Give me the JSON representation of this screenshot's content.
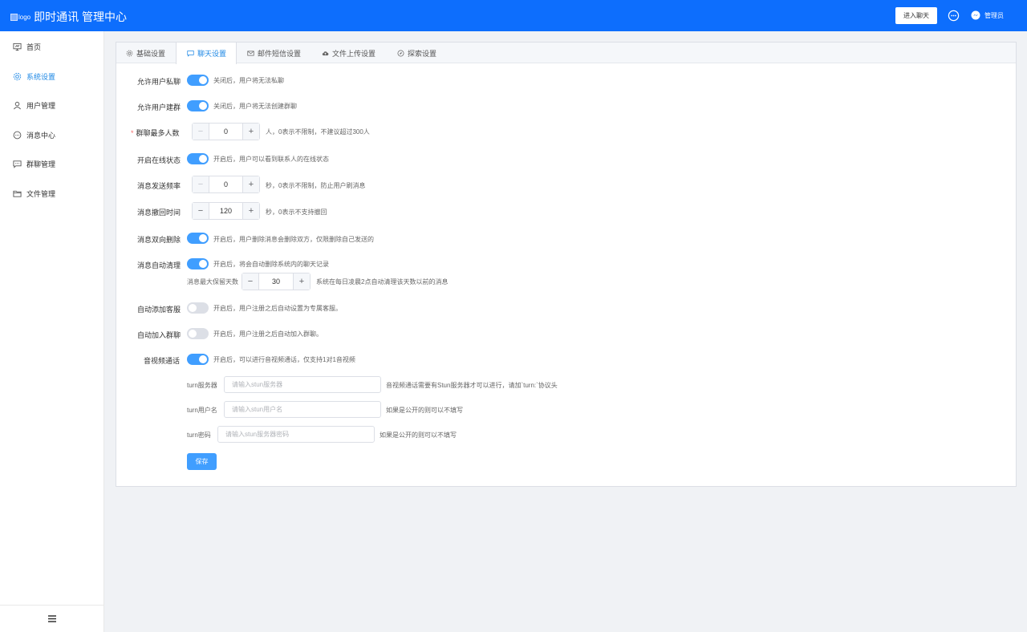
{
  "header": {
    "logo_alt": "logo",
    "title": "即时通讯 管理中心",
    "enter_chat": "进入聊天",
    "user": "管理员"
  },
  "sidebar": {
    "items": [
      {
        "label": "首页",
        "icon": "monitor-icon"
      },
      {
        "label": "系统设置",
        "icon": "gear-icon"
      },
      {
        "label": "用户管理",
        "icon": "user-icon"
      },
      {
        "label": "消息中心",
        "icon": "chat-bubble-icon"
      },
      {
        "label": "群聊管理",
        "icon": "group-chat-icon"
      },
      {
        "label": "文件管理",
        "icon": "folder-icon"
      }
    ],
    "active_index": 1
  },
  "tabs": [
    {
      "label": "基础设置",
      "icon": "gear-icon"
    },
    {
      "label": "聊天设置",
      "icon": "chat-icon"
    },
    {
      "label": "邮件短信设置",
      "icon": "mail-icon"
    },
    {
      "label": "文件上传设置",
      "icon": "cloud-upload-icon"
    },
    {
      "label": "探索设置",
      "icon": "compass-icon"
    }
  ],
  "active_tab": 1,
  "settings": {
    "private_chat": {
      "label": "允许用户私聊",
      "enabled": true,
      "hint": "关闭后，用户将无法私聊"
    },
    "create_group": {
      "label": "允许用户建群",
      "enabled": true,
      "hint": "关闭后，用户将无法创建群聊"
    },
    "max_group_members": {
      "label": "群聊最多人数",
      "required": true,
      "value": "0",
      "hint": "人，0表示不限制，不建议超过300人"
    },
    "online_status": {
      "label": "开启在线状态",
      "enabled": true,
      "hint": "开启后，用户可以看到联系人的在线状态"
    },
    "send_frequency": {
      "label": "消息发送频率",
      "value": "0",
      "hint": "秒，0表示不限制，防止用户刷消息"
    },
    "recall_time": {
      "label": "消息撤回时间",
      "value": "120",
      "hint": "秒，0表示不支持撤回"
    },
    "two_way_delete": {
      "label": "消息双向删除",
      "enabled": true,
      "hint": "开启后，用户删除消息会删除双方，仅限删除自己发送的"
    },
    "auto_clean": {
      "label": "消息自动清理",
      "enabled": true,
      "hint": "开启后，将会自动删除系统内的聊天记录",
      "retention_label": "消息最大保留天数",
      "retention_value": "30",
      "retention_hint": "系统在每日凌晨2点自动清理该天数以前的消息"
    },
    "auto_add_service": {
      "label": "自动添加客服",
      "enabled": false,
      "hint": "开启后，用户注册之后自动设置为专属客服。"
    },
    "auto_join_group": {
      "label": "自动加入群聊",
      "enabled": false,
      "hint": "开启后，用户注册之后自动加入群聊。"
    },
    "av_call": {
      "label": "音视频通话",
      "enabled": true,
      "hint": "开启后，可以进行音视频通话，仅支持1对1音视频",
      "turn_server": {
        "label": "turn服务器",
        "value": "",
        "placeholder": "请输入stun服务器",
        "hint": "音视频通话需要有Stun服务器才可以进行，请加`turn:`协议头"
      },
      "turn_user": {
        "label": "turn用户名",
        "value": "",
        "placeholder": "请输入stun用户名",
        "hint": "如果是公开的则可以不填写"
      },
      "turn_password": {
        "label": "turn密码",
        "value": "",
        "placeholder": "请输入stun服务器密码",
        "hint": "如果是公开的则可以不填写"
      }
    }
  },
  "save_label": "保存",
  "colors": {
    "header": "#0d6efd",
    "accent": "#409eff",
    "active_nav": "#1e88e5",
    "required": "#f56c6c"
  }
}
